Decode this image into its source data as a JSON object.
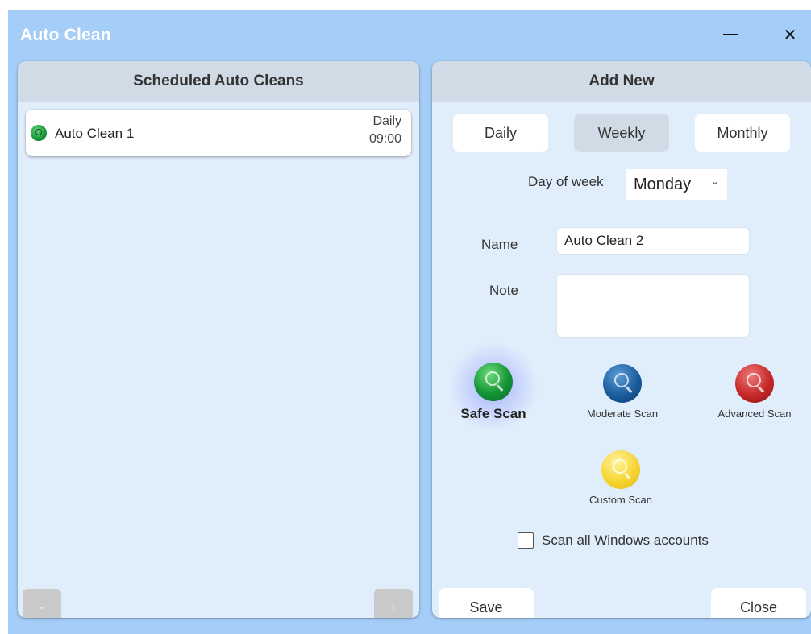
{
  "window": {
    "title": "Auto Clean",
    "close_glyph": "✕"
  },
  "left_panel": {
    "title": "Scheduled Auto Cleans",
    "items": [
      {
        "name": "Auto Clean 1",
        "frequency": "Daily",
        "time": "09:00",
        "icon": "safe-scan-icon"
      }
    ],
    "remove_label": "-",
    "add_label": "+"
  },
  "right_panel": {
    "title": "Add New",
    "frequency_tabs": [
      "Daily",
      "Weekly",
      "Monthly"
    ],
    "selected_frequency": "Weekly",
    "day_of_week": {
      "label": "Day of week",
      "value": "Monday"
    },
    "name": {
      "label": "Name",
      "value": "Auto Clean 2"
    },
    "note": {
      "label": "Note",
      "value": ""
    },
    "scans": {
      "safe": "Safe Scan",
      "moderate": "Moderate Scan",
      "advanced": "Advanced Scan",
      "custom": "Custom Scan"
    },
    "selected_scan": "Safe Scan",
    "scan_all_accounts": {
      "label": "Scan all Windows accounts",
      "checked": false
    },
    "save_label": "Save",
    "close_label": "Close"
  },
  "colors": {
    "window_bg": "#a4cdf8",
    "panel_bg": "#e0edfb",
    "header_bg": "#d0dbe6",
    "safe": "#139436",
    "moderate": "#1a5c9c",
    "advanced": "#c62828",
    "custom": "#f6d532"
  }
}
